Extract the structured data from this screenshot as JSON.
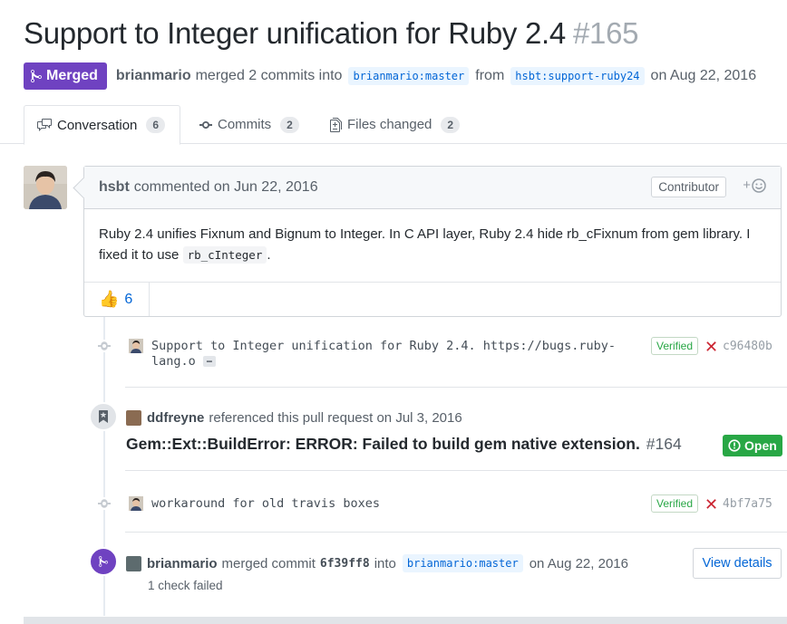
{
  "pr": {
    "title": "Support to Integer unification for Ruby 2.4",
    "number": "#165",
    "state": "Merged",
    "author": "brianmario",
    "merged_text": "merged 2 commits into",
    "base_branch": "brianmario:master",
    "from_text": "from",
    "head_branch": "hsbt:support-ruby24",
    "date_text": "on Aug 22, 2016"
  },
  "tabs": [
    {
      "label": "Conversation",
      "count": "6",
      "icon": "comment-discussion-icon"
    },
    {
      "label": "Commits",
      "count": "2",
      "icon": "git-commit-icon"
    },
    {
      "label": "Files changed",
      "count": "2",
      "icon": "file-diff-icon"
    }
  ],
  "comment": {
    "author": "hsbt",
    "header_text": "commented on Jun 22, 2016",
    "role": "Contributor",
    "body_text": "Ruby 2.4 unifies Fixnum and Bignum to Integer. In C API layer, Ruby 2.4 hide rb_cFixnum from gem library. I fixed it to use",
    "body_code": "rb_cInteger",
    "body_end": ".",
    "reaction_count": "6",
    "reaction_emoji": "+1"
  },
  "commits": [
    {
      "message_line1": "Support to Integer unification for Ruby 2.4. https://bugs.ruby-",
      "message_line2": "lang.o",
      "ellipsis": "…",
      "verified": "Verified",
      "status": "failure",
      "sha": "c96480b"
    },
    {
      "message_line1": "workaround for old travis boxes",
      "verified": "Verified",
      "status": "failure",
      "sha": "4bf7a75"
    }
  ],
  "reference": {
    "actor": "ddfreyne",
    "action": "referenced this pull request on Jul 3, 2016",
    "issue_title": "Gem::Ext::BuildError: ERROR: Failed to build gem native extension.",
    "issue_number": "#164",
    "issue_state": "Open"
  },
  "merge_event": {
    "actor": "brianmario",
    "action": "merged commit",
    "sha": "6f39ff8",
    "into_text": "into",
    "branch": "brianmario:master",
    "date_text": "on Aug 22, 2016",
    "button": "View details",
    "checks_text": "1 check failed"
  },
  "colors": {
    "merged": "#6f42c1",
    "open": "#28a745",
    "link": "#0366d6",
    "fail": "#cb2431"
  }
}
